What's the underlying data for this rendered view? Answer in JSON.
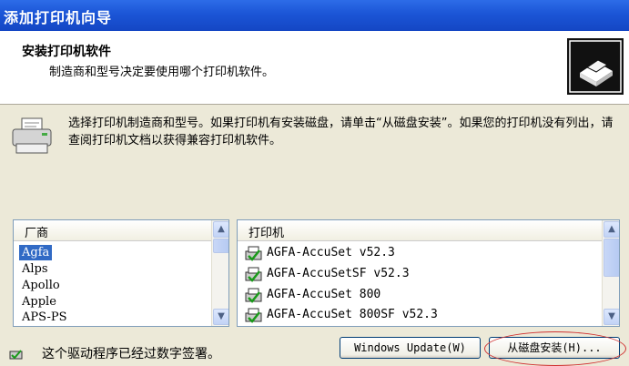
{
  "window": {
    "title": "添加打印机向导"
  },
  "header": {
    "title": "安装打印机软件",
    "subtitle": "制造商和型号决定要使用哪个打印机软件。"
  },
  "prompt": {
    "text": "选择打印机制造商和型号。如果打印机有安装磁盘，请单击“从磁盘安装”。如果您的打印机没有列出，请查阅打印机文档以获得兼容打印机软件。"
  },
  "manufacturers": {
    "header": "厂商",
    "items": [
      "Agfa",
      "Alps",
      "Apollo",
      "Apple",
      "APS-PS"
    ],
    "selected": "Agfa"
  },
  "printers": {
    "header": "打印机",
    "items": [
      "AGFA-AccuSet v52.3",
      "AGFA-AccuSetSF v52.3",
      "AGFA-AccuSet 800",
      "AGFA-AccuSet 800SF v52.3"
    ]
  },
  "buttons": {
    "windows_update": "Windows Update(W)",
    "have_disk": "从磁盘安装(H)..."
  },
  "signature": {
    "text": "这个驱动程序已经过数字签署。"
  },
  "colors": {
    "title_bar": "#1b55d6",
    "selection": "#316ac5",
    "highlight_circle": "#d03030"
  }
}
